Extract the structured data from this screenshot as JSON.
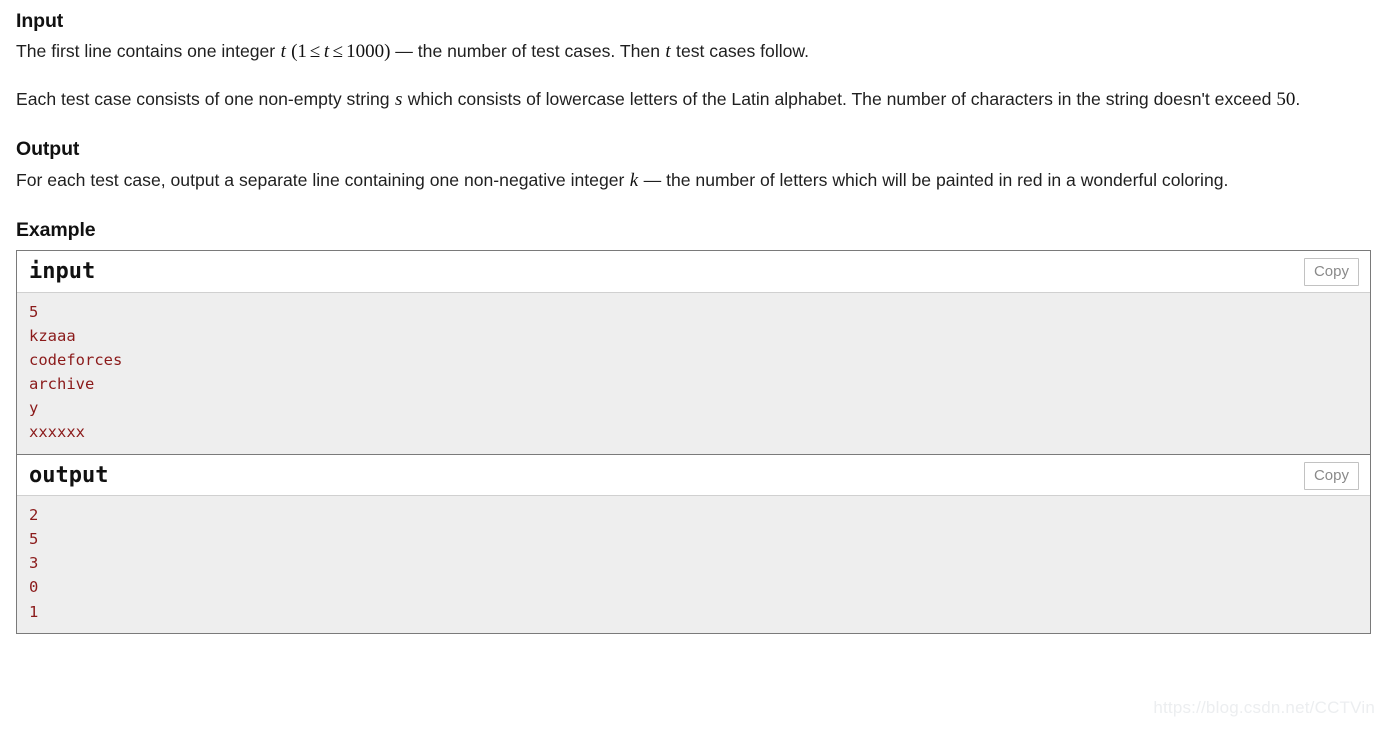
{
  "sections": {
    "input": {
      "heading": "Input",
      "para1": {
        "before": "The first line contains one integer ",
        "math": "t (1 ≤ t ≤ 1000)",
        "after": " — the number of test cases. Then ",
        "math2": "t",
        "after2": " test cases follow."
      },
      "para2": {
        "before": "Each test case consists of one non-empty string ",
        "math": "s",
        "after": " which consists of lowercase letters of the Latin alphabet. The number of characters in the string doesn't exceed ",
        "math2": "50",
        "after2": "."
      }
    },
    "output": {
      "heading": "Output",
      "para1": {
        "before": "For each test case, output a separate line containing one non-negative integer ",
        "math": "k",
        "after": " — the number of letters which will be painted in red in a wonderful coloring."
      }
    },
    "example": {
      "heading": "Example",
      "blocks": [
        {
          "title": "input",
          "copy_label": "Copy",
          "content": "5\nkzaaa\ncodeforces\narchive\ny\nxxxxxx"
        },
        {
          "title": "output",
          "copy_label": "Copy",
          "content": "2\n5\n3\n0\n1"
        }
      ]
    }
  },
  "math_symbols": {
    "t": "t",
    "s": "s",
    "k": "k",
    "one": "1",
    "thousand": "1000",
    "fifty": "50",
    "leq": "≤",
    "lparen": "(",
    "rparen": ")"
  },
  "watermark": "https://blog.csdn.net/CCTVin",
  "colors": {
    "sample_text_red": "#8b1a1a",
    "sample_body_bg": "#eeeeee",
    "border": "#7a7a7a",
    "copy_text": "#8a8a8a",
    "watermark": "#eceef0"
  }
}
